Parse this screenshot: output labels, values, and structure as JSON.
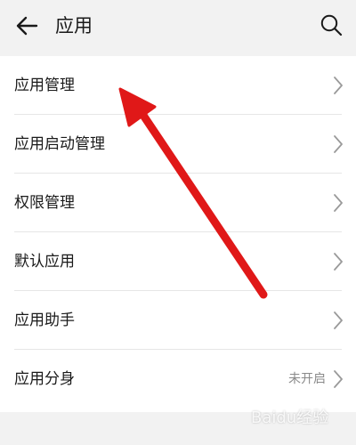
{
  "header": {
    "title": "应用"
  },
  "items": [
    {
      "label": "应用管理"
    },
    {
      "label": "应用启动管理"
    },
    {
      "label": "权限管理"
    },
    {
      "label": "默认应用"
    },
    {
      "label": "应用助手"
    },
    {
      "label": "应用分身",
      "value": "未开启"
    }
  ],
  "icons": {
    "back": "arrow-left-icon",
    "search": "search-icon",
    "chevron": "chevron-right-icon"
  },
  "annotation": {
    "arrow_color": "#e01818"
  },
  "watermark": {
    "text": "Baidu经验"
  }
}
